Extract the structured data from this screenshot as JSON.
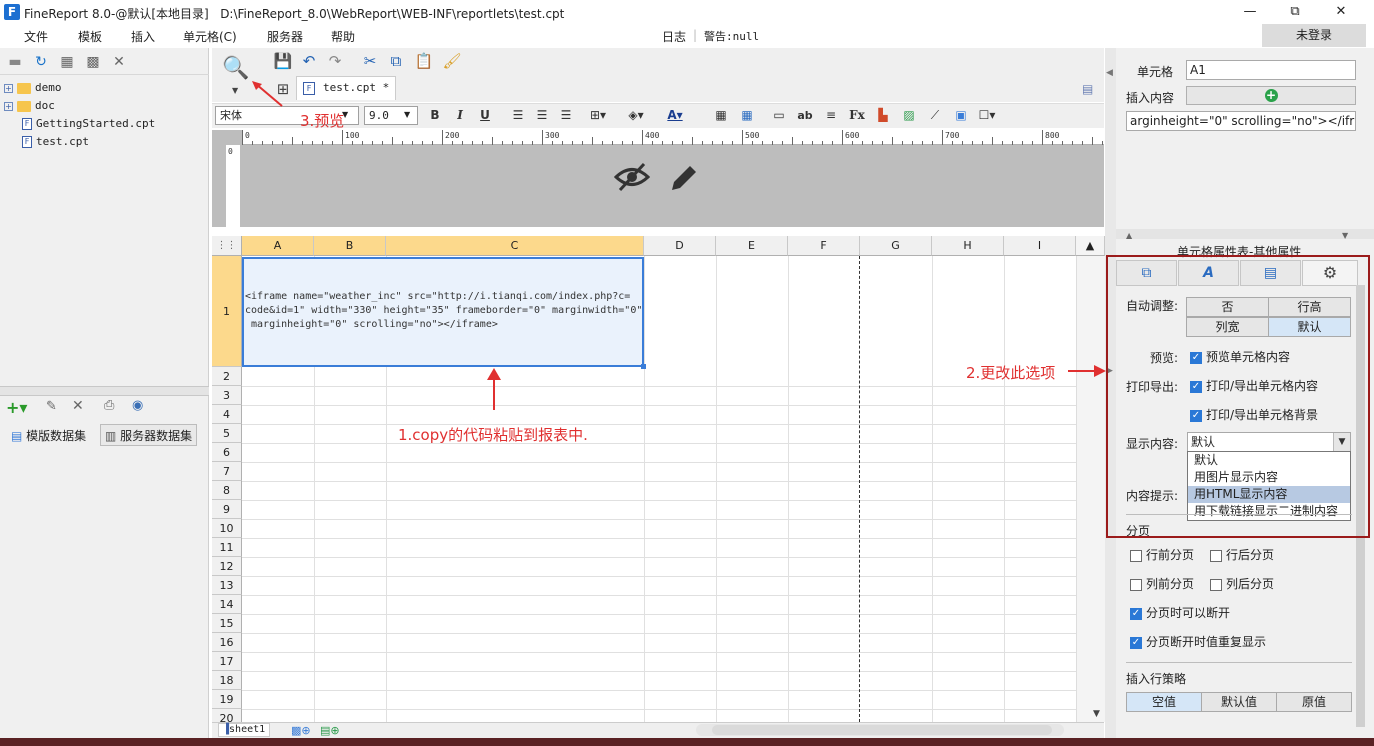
{
  "window": {
    "app_title": "FineReport 8.0-@默认[本地目录]",
    "path": "D:\\FineReport_8.0\\WebReport\\WEB-INF\\reportlets\\test.cpt",
    "minimize": "—",
    "restore": "⧉",
    "close": "✕"
  },
  "menubar": {
    "items": [
      "文件",
      "模板",
      "插入",
      "单元格(C)",
      "服务器",
      "帮助"
    ],
    "log": "日志",
    "warning": "警告:null",
    "login": "未登录"
  },
  "left_panel": {
    "tree": [
      {
        "label": "demo",
        "type": "folder"
      },
      {
        "label": "doc",
        "type": "folder"
      },
      {
        "label": "GettingStarted.cpt",
        "type": "file"
      },
      {
        "label": "test.cpt",
        "type": "file"
      }
    ],
    "dataset_tabs": [
      "模版数据集",
      "服务器数据集"
    ]
  },
  "editor": {
    "doc_tab": "test.cpt *",
    "font_name": "宋体",
    "font_size": "9.0",
    "ruler_ticks": [
      "0",
      "100",
      "200",
      "300",
      "400",
      "500",
      "600",
      "700",
      "800"
    ],
    "vruler_tick": "0",
    "columns": [
      "A",
      "B",
      "C",
      "D",
      "E",
      "F",
      "G",
      "H",
      "I"
    ],
    "rows": [
      "1",
      "2",
      "3",
      "4",
      "5",
      "6",
      "7",
      "8",
      "9",
      "10",
      "11",
      "12",
      "13",
      "14",
      "15",
      "16",
      "17",
      "18",
      "19",
      "20"
    ],
    "cell_a1": "<iframe name=\"weather_inc\" src=\"http://i.tianqi.com/index.php?c=\ncode&id=1\" width=\"330\" height=\"35\" frameborder=\"0\" marginwidth=\"0\"\n marginheight=\"0\" scrolling=\"no\"></iframe>",
    "sheet_tab": "sheet1"
  },
  "annotations": {
    "preview": "3.预览",
    "paste": "1.copy的代码粘贴到报表中.",
    "change": "2.更改此选项"
  },
  "right_panel": {
    "cell_label": "单元格",
    "cell_value": "A1",
    "insert_label": "插入内容",
    "content_preview": "arginheight=\"0\" scrolling=\"no\"></iframe>",
    "prop_title": "单元格属性表-其他属性",
    "auto_adjust_label": "自动调整:",
    "auto_adjust_options": [
      "否",
      "行高",
      "列宽",
      "默认"
    ],
    "preview_label": "预览:",
    "preview_check": "预览单元格内容",
    "print_label": "打印导出:",
    "print_check1": "打印/导出单元格内容",
    "print_check2": "打印/导出单元格背景",
    "display_label": "显示内容:",
    "display_value": "默认",
    "display_options": [
      "默认",
      "用图片显示内容",
      "用HTML显示内容",
      "用下载链接显示二进制内容"
    ],
    "tooltip_label": "内容提示:",
    "paging_label": "分页",
    "paging_checks": [
      "行前分页",
      "行后分页",
      "列前分页",
      "列后分页",
      "分页时可以断开",
      "分页断开时值重复显示"
    ],
    "insert_policy_label": "插入行策略",
    "insert_policy_options": [
      "空值",
      "默认值",
      "原值"
    ]
  },
  "colors": {
    "accent": "#3a7dd8",
    "annotation": "#e03030",
    "selected_header": "#fcd98c",
    "frame": "#9b1b1b"
  }
}
